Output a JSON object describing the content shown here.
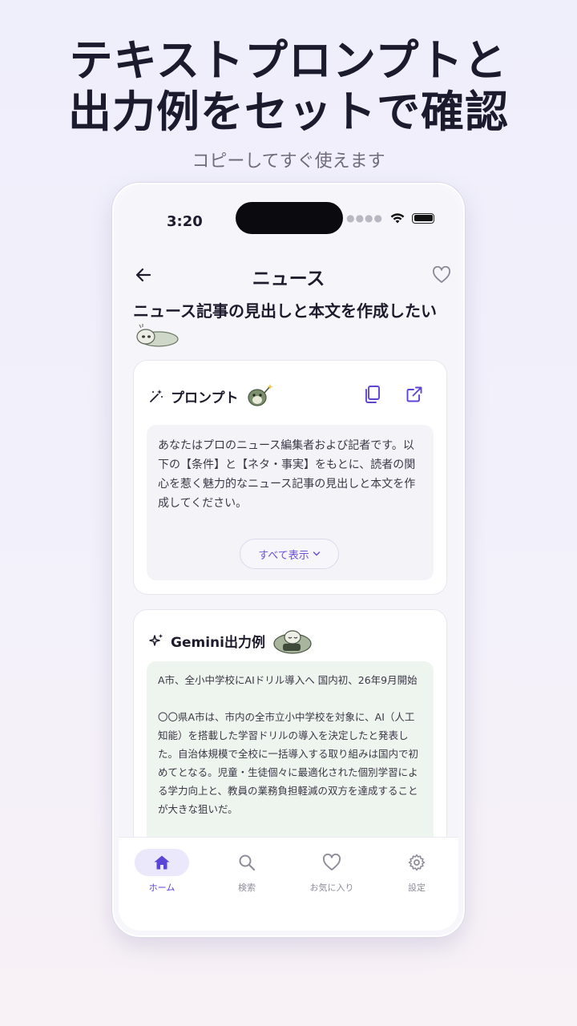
{
  "marketing": {
    "headline_line1": "テキストプロンプトと",
    "headline_line2": "出力例をセットで確認",
    "subhead": "コピーしてすぐ使えます"
  },
  "status_bar": {
    "time": "3:20"
  },
  "nav": {
    "title": "ニュース",
    "back_icon": "arrow-left-icon",
    "favorite_icon": "heart-outline-icon"
  },
  "page": {
    "heading": "ニュース記事の見出しと本文を作成したい"
  },
  "prompt_card": {
    "title": "プロンプト",
    "icon": "magic-wand-icon",
    "actions": [
      "copy-icon",
      "external-link-icon"
    ],
    "text": "あなたはプロのニュース編集者および記者です。以下の【条件】と【ネタ・事実】をもとに、読者の関心を惹く魅力的なニュース記事の見出しと本文を作成してください。",
    "show_all_label": "すべて表示"
  },
  "output_card": {
    "title": "Gemini出力例",
    "icon": "sparkles-icon",
    "text": "A市、全小中学校にAIドリル導入へ 国内初、26年9月開始\n\n〇〇県A市は、市内の全市立小中学校を対象に、AI（人工知能）を搭載した学習ドリルの導入を決定したと発表した。自治体規模で全校に一括導入する取り組みは国内で初めてとなる。児童・生徒個々に最適化された個別学習による学力向上と、教員の業務負担軽減の双方を達成することが大きな狙いだ。"
  },
  "tabbar": {
    "items": [
      {
        "label": "ホーム",
        "icon": "home-icon",
        "active": true
      },
      {
        "label": "検索",
        "icon": "search-icon",
        "active": false
      },
      {
        "label": "お気に入り",
        "icon": "heart-icon",
        "active": false
      },
      {
        "label": "設定",
        "icon": "gear-icon",
        "active": false
      }
    ]
  },
  "colors": {
    "accent": "#5b45d6",
    "output_bg": "#eef4ee",
    "prompt_bg": "#f4f3f8"
  }
}
